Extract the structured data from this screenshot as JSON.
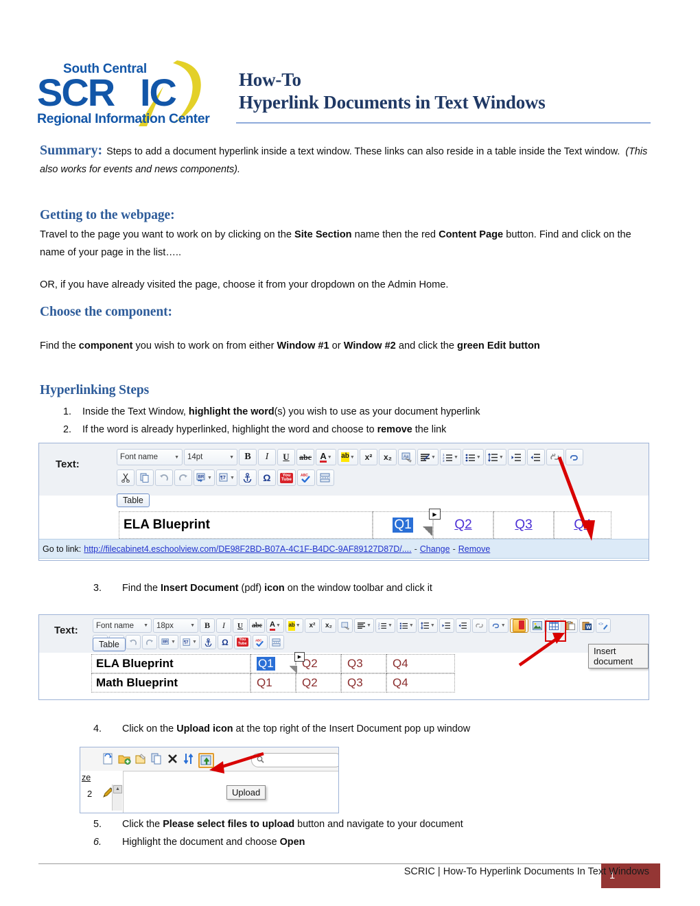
{
  "header": {
    "logo_top": "South Central",
    "logo_main": "SCRIC",
    "logo_bottom": "Regional Information Center",
    "title_line1": "How-To",
    "title_line2": "Hyperlink Documents in Text Windows"
  },
  "summary": {
    "label": "Summary:",
    "text_part1": "Steps to add a document hyperlink inside a text window. These links can also reside in a table inside the Text window.",
    "text_italic": "(This also works for events and news components)."
  },
  "sections": {
    "webpage": {
      "heading": "Getting to the webpage:",
      "para1_a": "Travel to the page you want to work on by clicking on the ",
      "para1_b": "Site Section",
      "para1_c": " name then the red ",
      "para1_d": "Content Page",
      "para1_e": " button.  Find and click on the name of your page in the list…..",
      "para2": "OR, if you have already visited the page, choose it from your dropdown on the Admin Home."
    },
    "component": {
      "heading": "Choose the component:",
      "para_a": "Find the ",
      "para_b": "component",
      "para_c": " you wish to work on from either ",
      "para_d": "Window #1",
      "para_e": " or ",
      "para_f": "Window #2",
      "para_g": " and click the ",
      "para_h": "green Edit button"
    },
    "steps": {
      "heading": "Hyperlinking Steps"
    }
  },
  "steps": [
    {
      "num": "1.",
      "a": "Inside the Text Window, ",
      "b": "highlight the word",
      "c": "(s) you wish to use as your document hyperlink"
    },
    {
      "num": "2.",
      "a": "If the word is already hyperlinked, highlight the word and choose to ",
      "b": "remove",
      "c": " the link"
    },
    {
      "num": "3.",
      "a": "Find the ",
      "b": "Insert Document",
      "c": " (pdf) ",
      "d": "icon",
      "e": " on the window toolbar and click it"
    },
    {
      "num": "4.",
      "a": "Click on the ",
      "b": "Upload icon",
      "c": " at the top right of the Insert Document pop up window"
    },
    {
      "num": "5.",
      "a": "Click the ",
      "b": "Please select files to upload",
      "c": " button and navigate to your document"
    },
    {
      "num": "6.",
      "a": "Highlight the document and choose ",
      "b": "Open",
      "c": ""
    }
  ],
  "screenshot1": {
    "text_label": "Text:",
    "font_name": "Font name",
    "font_size": "14pt",
    "table_button": "Table",
    "row_title": "ELA Blueprint",
    "quarters": [
      "Q1",
      "Q2",
      "Q3",
      "Q4"
    ],
    "goto_label": "Go to link:",
    "url": "http://filecabinet4.eschoolview.com/DE98F2BD-B07A-4C1F-B4DC-9AF89127D87D/....",
    "dash": "-",
    "change": "Change",
    "remove": "Remove",
    "toolbar_icons": [
      "bold",
      "italic",
      "underline",
      "strikethrough",
      "font-color",
      "highlight-color",
      "superscript",
      "subscript",
      "remove-format",
      "alignment",
      "numbered-list",
      "bullet-list",
      "line-spacing",
      "indent",
      "outdent",
      "unlink",
      "cut",
      "copy",
      "undo",
      "redo",
      "paste-special",
      "insert-template",
      "anchor",
      "special-character",
      "youtube",
      "spellcheck",
      "page-break"
    ]
  },
  "screenshot2": {
    "text_label": "Text:",
    "font_name": "Font name",
    "font_size": "18px",
    "table_button": "Table",
    "rows": [
      {
        "title": "ELA Blueprint",
        "quarters": [
          "Q1",
          "Q2",
          "Q3",
          "Q4"
        ]
      },
      {
        "title": "Math Blueprint",
        "quarters": [
          "Q1",
          "Q2",
          "Q3",
          "Q4"
        ]
      }
    ],
    "tooltip": "Insert document",
    "toolbar_icons": [
      "indent",
      "outdent",
      "unlink",
      "link",
      "insert-document-pdf",
      "insert-image",
      "insert-table",
      "paste",
      "paste-word",
      "clean-html"
    ]
  },
  "screenshot3": {
    "tooltip": "Upload",
    "size_column": "ze",
    "row_value": "2",
    "icons": [
      "refresh-icon",
      "new-folder-icon",
      "rename-icon",
      "copy-icon",
      "delete-icon",
      "move-icon",
      "upload-icon",
      "search-icon"
    ]
  },
  "footer": {
    "text": "SCRIC | How-To Hyperlink Documents In Text Windows",
    "page_number": "1"
  },
  "colors": {
    "title_navy": "#1F3864",
    "heading_blue": "#2E5C9A",
    "rule_blue": "#8EAADB",
    "footer_red": "#943634",
    "logo_blue": "#1256A8",
    "logo_yellow": "#E3D028",
    "arrow_red": "#D80000"
  }
}
